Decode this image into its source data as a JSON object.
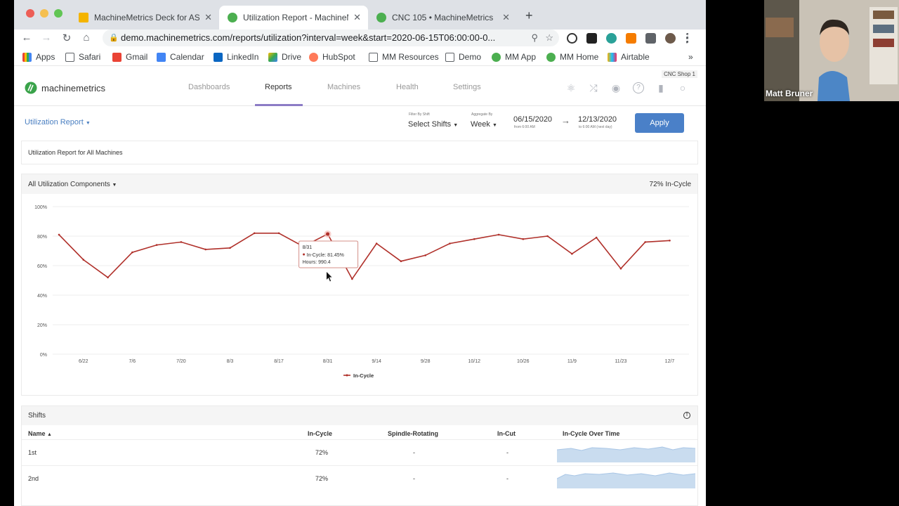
{
  "browser": {
    "tabs": [
      {
        "title": "MachineMetrics Deck for ASQ",
        "active": false
      },
      {
        "title": "Utilization Report - MachineMe",
        "active": true
      },
      {
        "title": "CNC 105 • MachineMetrics",
        "active": false
      }
    ],
    "url": "demo.machinemetrics.com/reports/utilization?interval=week&start=2020-06-15T06:00:00-0...",
    "bookmarks": [
      "Apps",
      "Safari",
      "Gmail",
      "Calendar",
      "LinkedIn",
      "Drive",
      "HubSpot",
      "MM Resources",
      "Demo",
      "MM App",
      "MM Home",
      "Airtable"
    ],
    "close_glyph": "✕",
    "new_tab_glyph": "+",
    "overflow_glyph": "»"
  },
  "app": {
    "shop_tag": "CNC Shop 1",
    "logo_text": "machinemetrics",
    "nav": [
      "Dashboards",
      "Reports",
      "Machines",
      "Health",
      "Settings"
    ],
    "active_nav": "Reports",
    "report_dropdown": "Utilization Report",
    "filter_shift_label": "Filter By Shift",
    "filter_shift_value": "Select Shifts",
    "aggregate_label": "Aggregate By",
    "aggregate_value": "Week",
    "start_date": "06/15/2020",
    "start_sub": "from 6:00 AM",
    "end_date": "12/13/2020",
    "end_sub": "to 6:00 AM (next day)",
    "apply_label": "Apply",
    "report_title": "Utilization Report for All Machines",
    "components_dropdown": "All Utilization Components",
    "incycle_summary": "72% In-Cycle",
    "accent_color": "#4a80c8",
    "line_color": "#b0302a"
  },
  "chart_data": {
    "type": "line",
    "x": [
      "6/15",
      "6/22",
      "6/29",
      "7/6",
      "7/13",
      "7/20",
      "7/27",
      "8/3",
      "8/10",
      "8/17",
      "8/24",
      "8/31",
      "9/7",
      "9/14",
      "9/21",
      "9/28",
      "10/5",
      "10/12",
      "10/19",
      "10/26",
      "11/2",
      "11/9",
      "11/16",
      "11/23",
      "11/30",
      "12/7",
      "12/14"
    ],
    "x_tick_labels": [
      "6/22",
      "7/6",
      "7/20",
      "8/3",
      "8/17",
      "8/31",
      "9/14",
      "9/28",
      "10/12",
      "10/26",
      "11/9",
      "11/23",
      "12/7"
    ],
    "series": [
      {
        "name": "In-Cycle",
        "values": [
          81,
          64,
          52,
          69,
          74,
          76,
          71,
          72,
          82,
          82,
          73,
          81.45,
          51,
          75,
          63,
          67,
          75,
          78,
          81,
          78,
          80,
          68,
          79,
          58,
          76,
          77
        ]
      }
    ],
    "ylim": [
      0,
      100
    ],
    "y_ticks": [
      "0%",
      "20%",
      "40%",
      "60%",
      "80%",
      "100%"
    ],
    "grid": true,
    "legend": "bottom-center",
    "tooltip": {
      "date": "8/31",
      "line1": "In-Cycle: 81.45%",
      "line2": "Hours: 990.4"
    }
  },
  "shifts": {
    "title": "Shifts",
    "info_glyph": "!",
    "columns": [
      "Name",
      "In-Cycle",
      "Spindle-Rotating",
      "In-Cut",
      "In-Cycle Over Time"
    ],
    "rows": [
      {
        "name": "1st",
        "in_cycle": "72%",
        "spindle": "-",
        "in_cut": "-"
      },
      {
        "name": "2nd",
        "in_cycle": "72%",
        "spindle": "-",
        "in_cut": "-"
      }
    ]
  },
  "video": {
    "name": "Matt Bruner"
  }
}
